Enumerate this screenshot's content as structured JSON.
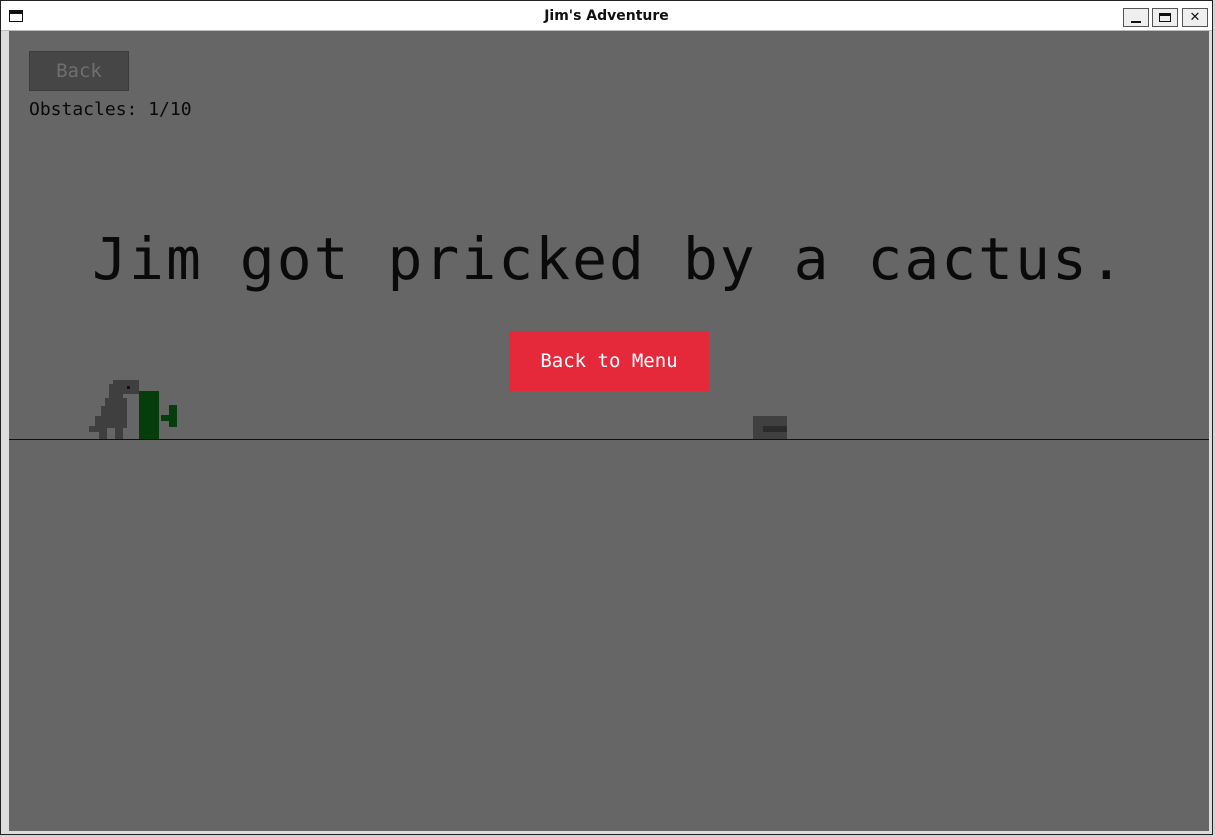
{
  "window": {
    "title": "Jim's Adventure",
    "minimize_label": "_",
    "maximize_label": "□",
    "close_label": "✕"
  },
  "hud": {
    "back_label": "Back",
    "obstacles_text": "Obstacles: 1/10"
  },
  "game_over": {
    "message": "Jim got pricked by a cactus.",
    "menu_button_label": "Back to Menu"
  },
  "colors": {
    "background": "#666666",
    "menu_button": "#e5293a",
    "cactus": "#063d0c",
    "dino": "#3f3f3f",
    "rock": "#404040",
    "text": "#0a0a0a"
  },
  "icons": [
    "app-window-icon",
    "minimize-icon",
    "maximize-icon",
    "close-icon"
  ]
}
